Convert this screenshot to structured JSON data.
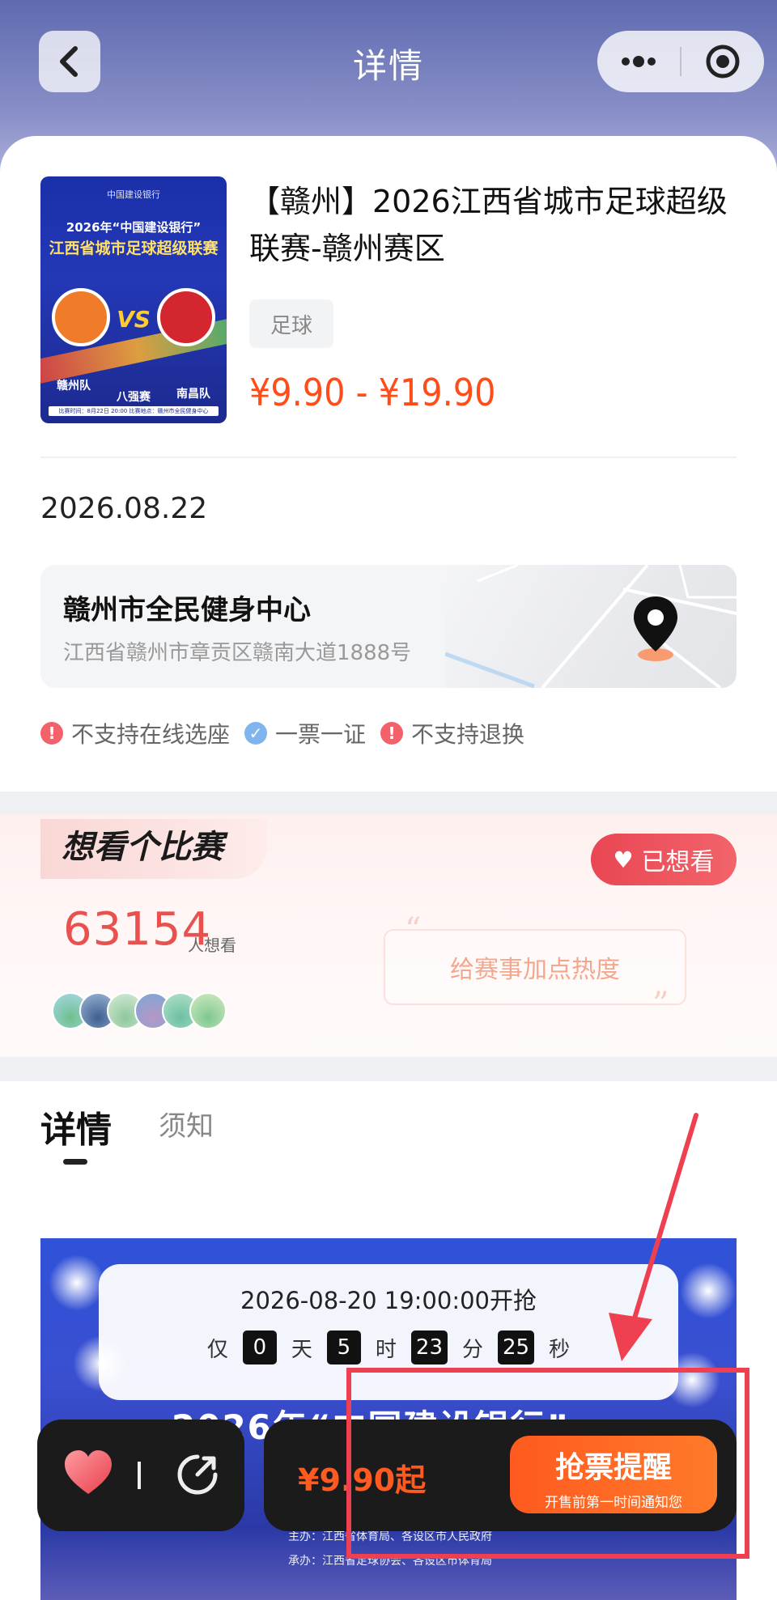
{
  "header": {
    "title": "详情"
  },
  "event": {
    "title": "【赣州】2026江西省城市足球超级联赛-赣州赛区",
    "tag": "足球",
    "price_range": "¥9.90 - ¥19.90",
    "date": "2026.08.22",
    "poster": {
      "top": "中国建设银行",
      "line1": "2026年“中国建设银行”",
      "line2": "江西省城市足球超级联赛",
      "vs": "VS",
      "team_left": "赣州队",
      "team_right": "南昌队",
      "round": "八强赛",
      "footer": "比赛时间：8月22日 20:00 比赛地点：赣州市全民健身中心"
    }
  },
  "venue": {
    "name": "赣州市全民健身中心",
    "address": "江西省赣州市章贡区赣南大道1888号"
  },
  "features": [
    {
      "label": "不支持在线选座",
      "type": "warn",
      "glyph": "!"
    },
    {
      "label": "一票一证",
      "type": "ok",
      "glyph": "✓"
    },
    {
      "label": "不支持退换",
      "type": "warn",
      "glyph": "!"
    }
  ],
  "want": {
    "title": "想看个比赛",
    "button": "已想看",
    "count": "63154",
    "unit": "人想看",
    "heat_text": "给赛事加点热度",
    "avatar_colors": [
      "#7fc8a0",
      "#5a7fb8",
      "#9ec9a8",
      "#c7a6c9",
      "#6fc0a5",
      "#88c79a"
    ]
  },
  "tabs": {
    "detail": "详情",
    "notice": "须知"
  },
  "countdown": {
    "title": "2026-08-20 19:00:00开抢",
    "prefix": "仅",
    "days": "0",
    "days_unit": "天",
    "hours": "5",
    "hours_unit": "时",
    "minutes": "23",
    "minutes_unit": "分",
    "seconds": "25",
    "seconds_unit": "秒"
  },
  "detail_image": {
    "headline": "2026年“中国建设银行”",
    "sub1": "主办：江西省体育局、各设区市人民政府",
    "sub2": "承办：江西省足球协会、各设区市体育局"
  },
  "bottom_bar": {
    "price": "¥9.90起",
    "remind_title": "抢票提醒",
    "remind_sub": "开售前第一时间通知您"
  },
  "colors": {
    "accent": "#ff4d1a",
    "want_red": "#e8514f",
    "header_bg": "#6b75b8"
  }
}
